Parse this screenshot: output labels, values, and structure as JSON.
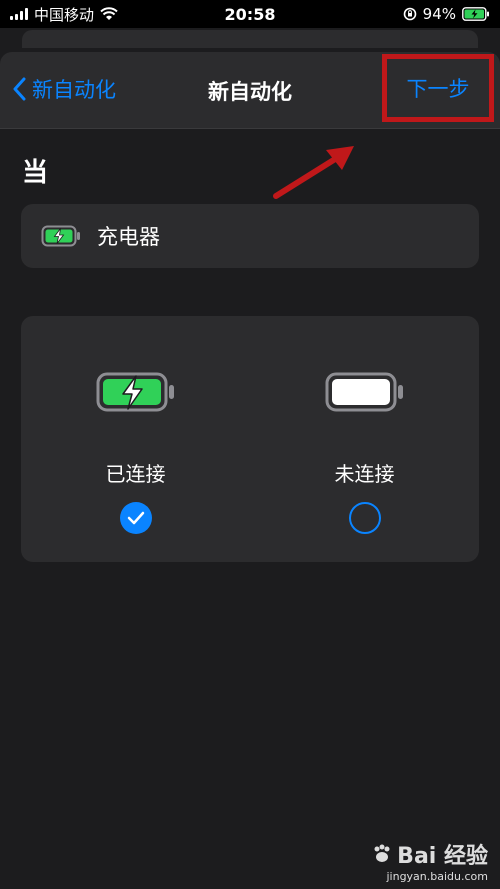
{
  "status": {
    "carrier": "中国移动",
    "time": "20:58",
    "battery_pct": "94%",
    "icons": [
      "signal-icon",
      "wifi-icon",
      "rotation-lock-icon",
      "battery-charging-icon"
    ]
  },
  "nav": {
    "back_label": "新自动化",
    "title": "新自动化",
    "next_label": "下一步"
  },
  "section": {
    "when_label": "当"
  },
  "trigger": {
    "label": "充电器",
    "icon": "battery-charging-icon"
  },
  "options": [
    {
      "label": "已连接",
      "icon": "battery-charging-icon",
      "selected": true
    },
    {
      "label": "未连接",
      "icon": "battery-full-icon",
      "selected": false
    }
  ],
  "watermark": {
    "brand": "Bai 经验",
    "url": "jingyan.baidu.com"
  },
  "colors": {
    "accent": "#0a84ff",
    "highlight": "#c0181a",
    "battery_green": "#30d158",
    "background": "#1c1c1e",
    "card": "#2c2c2e"
  }
}
